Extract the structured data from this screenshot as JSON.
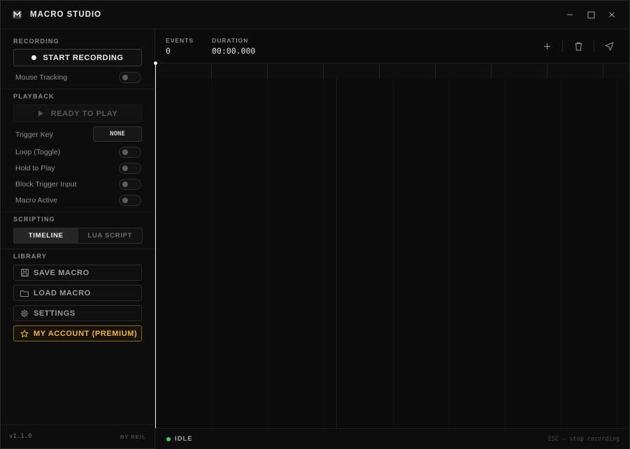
{
  "app": {
    "title": "MACRO STUDIO"
  },
  "window_controls": {
    "minimize": "minimize-icon",
    "maximize": "maximize-icon",
    "close": "close-icon"
  },
  "sidebar": {
    "recording": {
      "section_label": "RECORDING",
      "record_button": "START RECORDING",
      "mouse_tracking_label": "Mouse Tracking",
      "mouse_tracking_on": false
    },
    "playback": {
      "section_label": "PLAYBACK",
      "play_button": "READY TO PLAY",
      "trigger_key_label": "Trigger Key",
      "trigger_key_value": "NONE",
      "options": [
        {
          "label": "Loop (Toggle)",
          "on": false
        },
        {
          "label": "Hold to Play",
          "on": false
        },
        {
          "label": "Block Trigger Input",
          "on": false
        },
        {
          "label": "Macro Active",
          "on": false
        }
      ]
    },
    "scripting": {
      "section_label": "SCRIPTING",
      "tabs": [
        {
          "label": "TIMELINE",
          "active": true
        },
        {
          "label": "LUA SCRIPT",
          "active": false
        }
      ]
    },
    "library": {
      "section_label": "LIBRARY",
      "save_label": "SAVE MACRO",
      "load_label": "LOAD MACRO",
      "settings_label": "SETTINGS",
      "account_label": "MY ACCOUNT (PREMIUM)"
    },
    "footer": {
      "version": "v1.1.0",
      "byline": "BY REIL"
    }
  },
  "main": {
    "stats": {
      "events_label": "EVENTS",
      "events_value": "0",
      "duration_label": "DURATION",
      "duration_value": "00:00.000"
    },
    "toolbar_icons": [
      "plus-icon",
      "trash-icon",
      "cursor-icon"
    ]
  },
  "status": {
    "state": "IDLE",
    "hint": "ESC — stop recording"
  },
  "colors": {
    "accent_premium": "#f2b630",
    "status_idle": "#3ed36a"
  }
}
